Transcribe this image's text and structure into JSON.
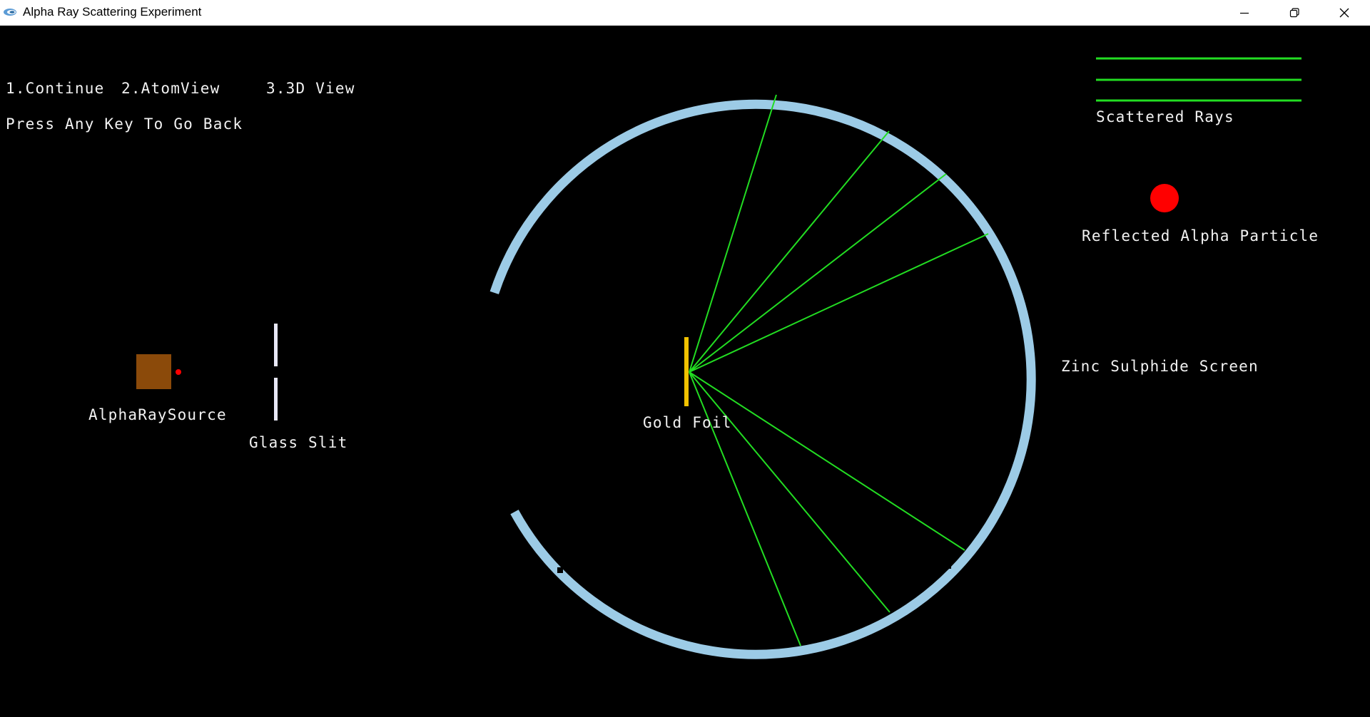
{
  "window": {
    "title": "Alpha Ray Scattering Experiment",
    "app_icon": "app-icon",
    "controls": {
      "minimize_icon": "minimize-icon",
      "maximize_icon": "restore-icon",
      "close_icon": "close-icon"
    }
  },
  "menu": {
    "option_1": "1.Continue",
    "option_2": "2.AtomView",
    "option_3": "3.3D View",
    "back_hint": "Press Any Key To Go Back"
  },
  "apparatus": {
    "source_label": "AlphaRaySource",
    "slit_label": "Glass Slit",
    "foil_label": "Gold Foil",
    "screen_label": "Zinc Sulphide Screen"
  },
  "legend": {
    "rays_label": "Scattered Rays",
    "particle_label": "Reflected Alpha Particle"
  },
  "colors": {
    "background": "#000000",
    "screen": "#9ccbe6",
    "ray": "#22dd22",
    "foil": "#f2c200",
    "source": "#8b4a0a",
    "particle": "#ff0000",
    "slit": "#e8e8f8",
    "text": "#f2f2f2"
  }
}
